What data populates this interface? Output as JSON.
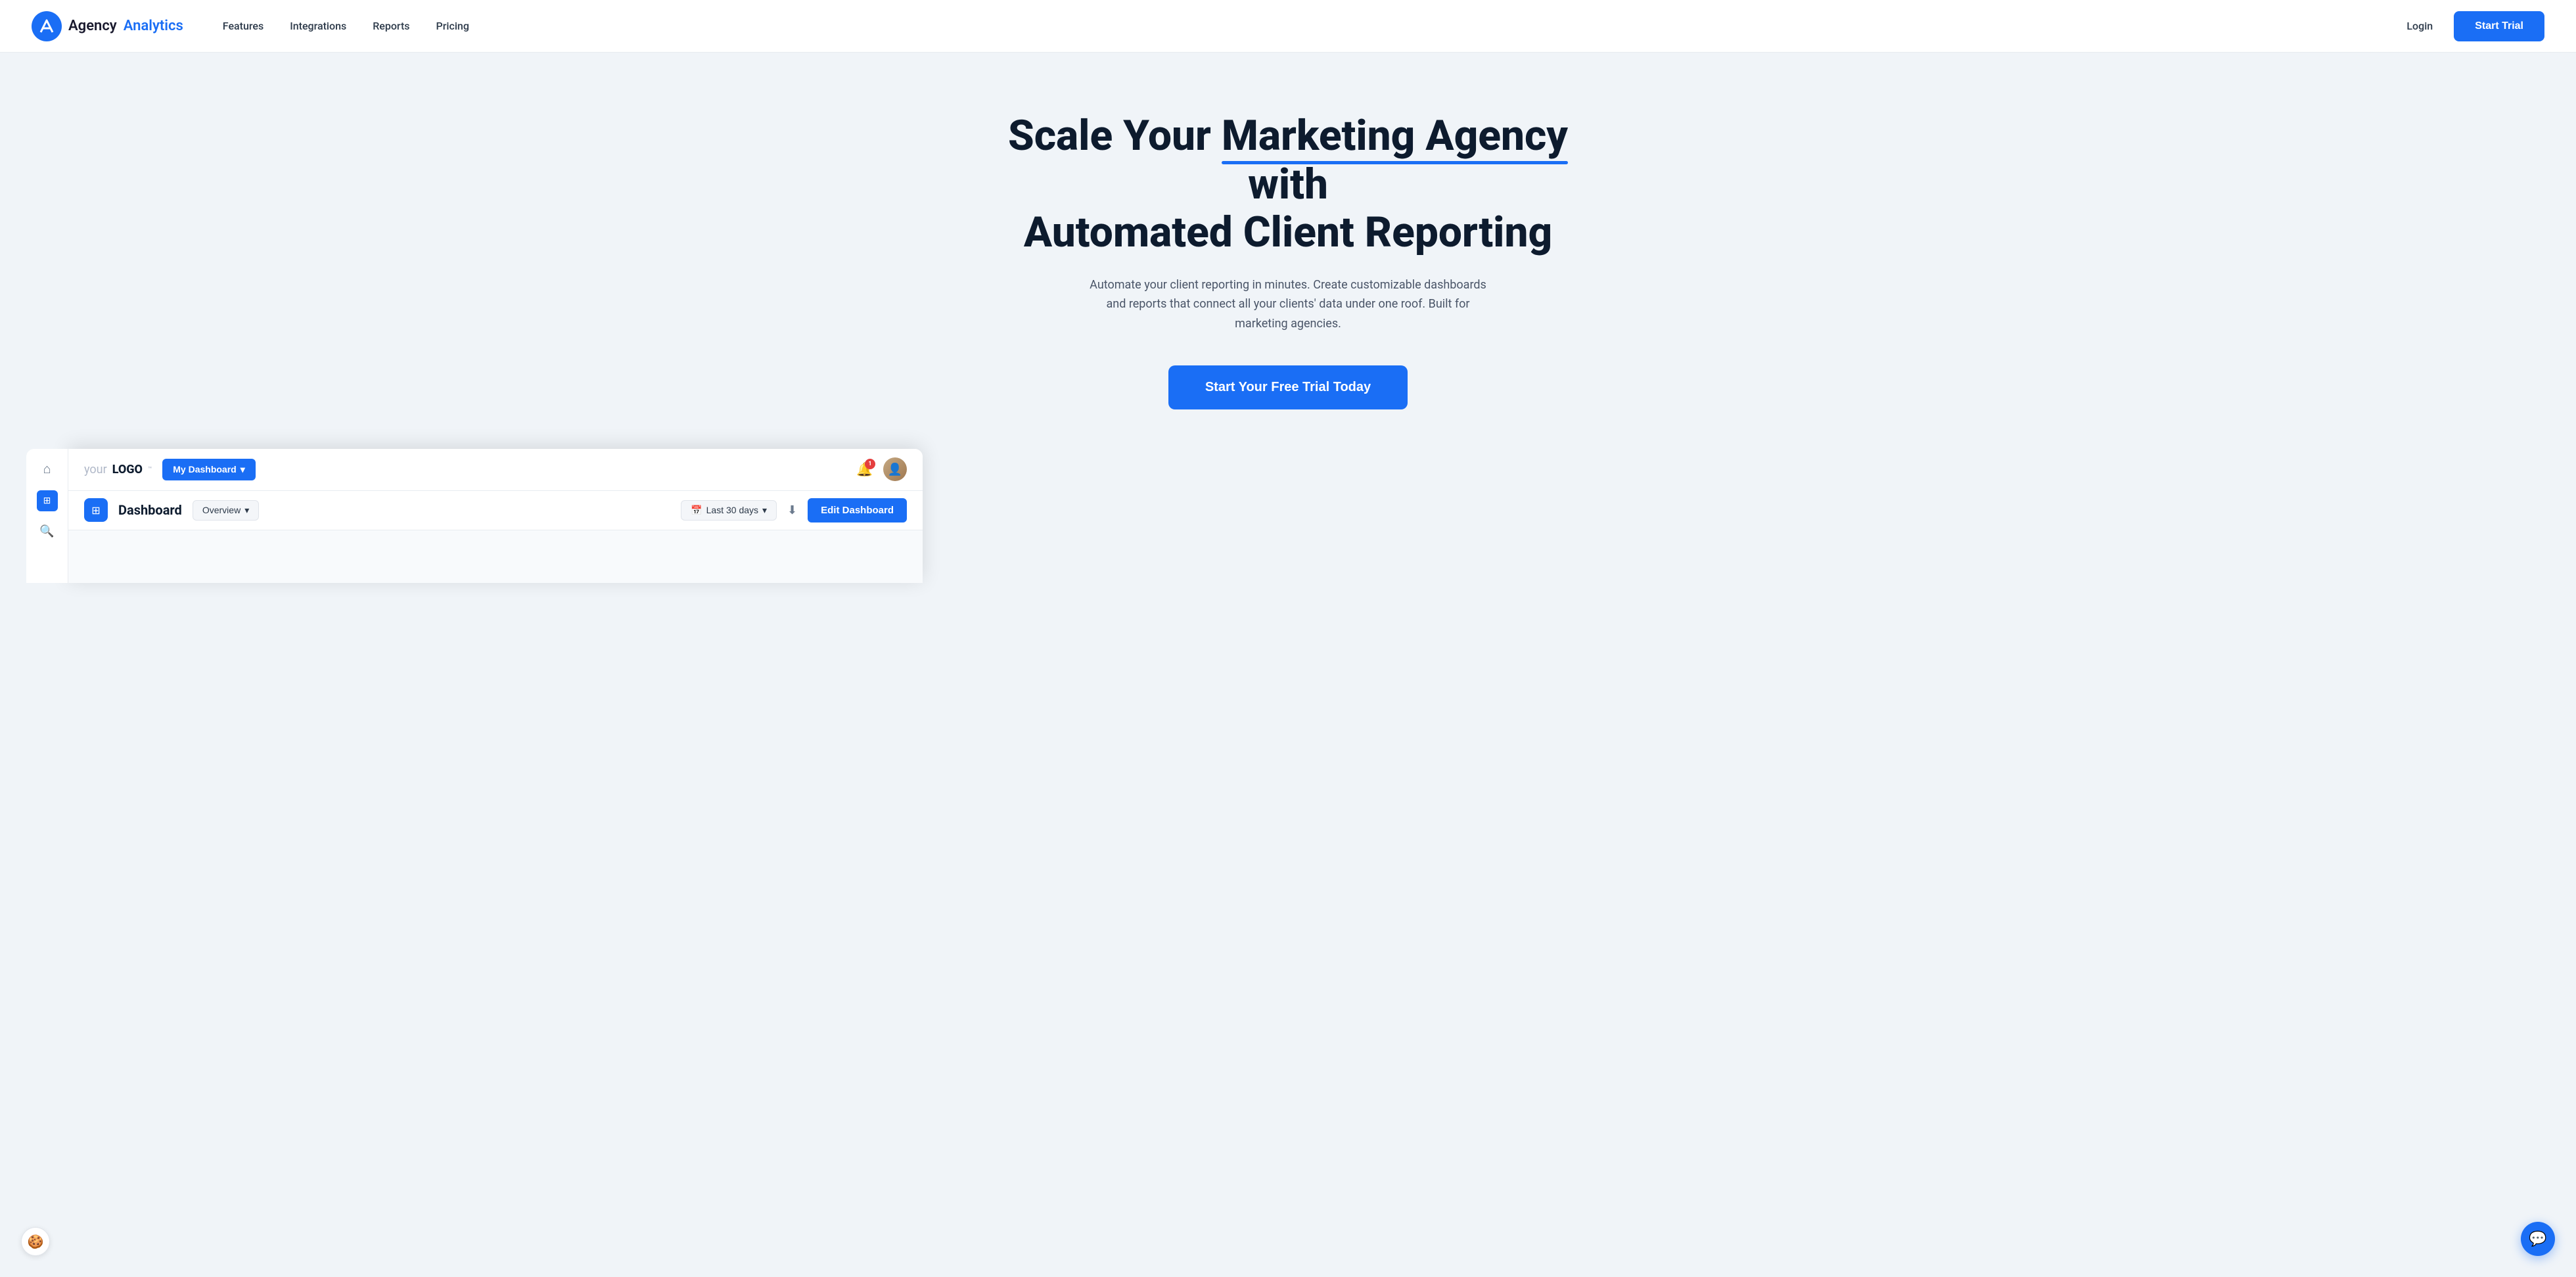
{
  "navbar": {
    "logo_agency": "Agency",
    "logo_analytics": "Analytics",
    "links": [
      {
        "id": "features",
        "label": "Features"
      },
      {
        "id": "integrations",
        "label": "Integrations"
      },
      {
        "id": "reports",
        "label": "Reports"
      },
      {
        "id": "pricing",
        "label": "Pricing"
      }
    ],
    "login_label": "Login",
    "start_trial_label": "Start Trial"
  },
  "hero": {
    "title_part1": "Scale Your ",
    "title_highlight": "Marketing Agency",
    "title_part2": " with",
    "title_line2": "Automated Client Reporting",
    "subtitle": "Automate your client reporting in minutes. Create customizable dashboards and reports that connect all your clients' data under one roof. Built for marketing agencies.",
    "cta_label": "Start Your Free Trial Today"
  },
  "dashboard": {
    "topbar": {
      "home_icon": "⌂",
      "logo_your": "your",
      "logo_logo": "LOGO",
      "logo_tm": "™",
      "dropdown_label": "My Dashboard",
      "dropdown_icon": "▾",
      "bell_icon": "🔔",
      "bell_count": "1",
      "avatar_icon": "👤"
    },
    "subheader": {
      "sidebar_grid_icon": "⊞",
      "title": "Dashboard",
      "overview_label": "Overview",
      "overview_icon": "▾",
      "date_icon": "📅",
      "date_label": "Last 30 days",
      "date_dropdown": "▾",
      "download_icon": "⬇",
      "edit_label": "Edit Dashboard"
    }
  },
  "chat": {
    "icon": "💬"
  },
  "cookie": {
    "icon": "🍪"
  }
}
